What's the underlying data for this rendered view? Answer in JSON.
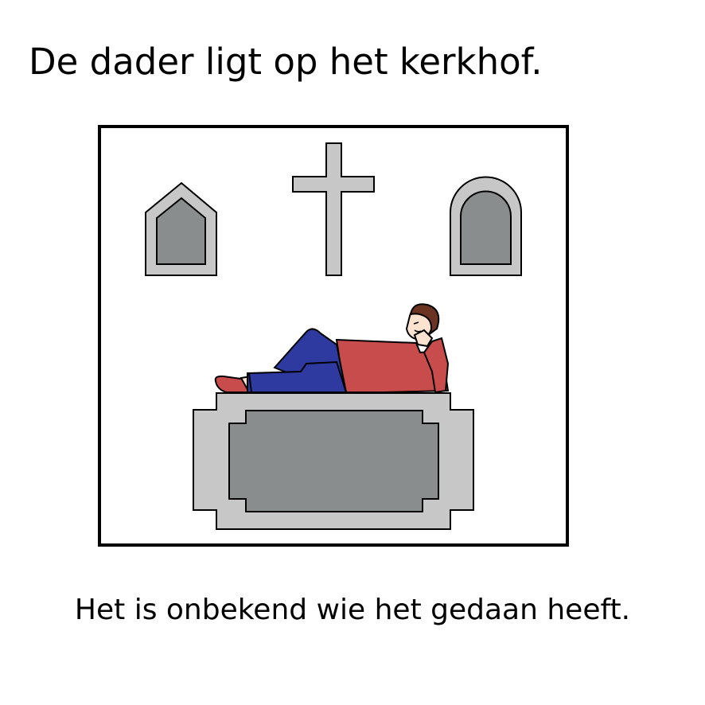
{
  "heading": "De dader ligt op het kerkhof.",
  "caption": "Het is onbekend wie het gedaan heeft.",
  "illustration": {
    "icons": [
      "pointed-gravestone-icon",
      "cross-icon",
      "rounded-gravestone-icon",
      "tomb-icon",
      "man-lying-icon"
    ],
    "colors": {
      "frame": "#000000",
      "stone_light": "#c6c7c6",
      "stone_dark": "#8a8d8d",
      "shirt": "#c84c4c",
      "trousers": "#2f3aa0",
      "skin": "#fbe3d0",
      "hair": "#6b3422"
    }
  }
}
